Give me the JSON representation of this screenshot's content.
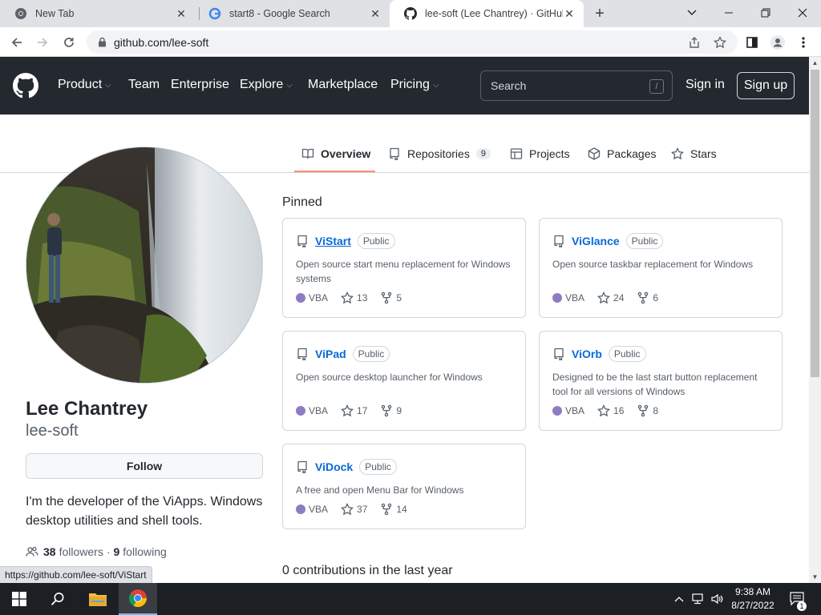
{
  "browser": {
    "tabs": [
      {
        "title": "New Tab"
      },
      {
        "title": "start8 - Google Search"
      },
      {
        "title": "lee-soft (Lee Chantrey) · GitHub"
      }
    ],
    "url": "github.com/lee-soft",
    "status_url": "https://github.com/lee-soft/ViStart"
  },
  "header": {
    "nav": [
      {
        "label": "Product",
        "dropdown": true
      },
      {
        "label": "Team",
        "dropdown": false
      },
      {
        "label": "Enterprise",
        "dropdown": false
      },
      {
        "label": "Explore",
        "dropdown": true
      },
      {
        "label": "Marketplace",
        "dropdown": false
      },
      {
        "label": "Pricing",
        "dropdown": true
      }
    ],
    "search_placeholder": "Search",
    "search_key": "/",
    "sign_in": "Sign in",
    "sign_up": "Sign up"
  },
  "profile_tabs": [
    {
      "label": "Overview",
      "icon": "book-icon"
    },
    {
      "label": "Repositories",
      "count": "9",
      "icon": "repo-icon"
    },
    {
      "label": "Projects",
      "icon": "table-icon"
    },
    {
      "label": "Packages",
      "icon": "package-icon"
    },
    {
      "label": "Stars",
      "icon": "star-icon"
    }
  ],
  "profile": {
    "name": "Lee Chantrey",
    "username": "lee-soft",
    "follow": "Follow",
    "bio": "I'm the developer of the ViApps. Windows desktop utilities and shell tools.",
    "followers_count": "38",
    "followers_label": "followers",
    "dot": "·",
    "following_count": "9",
    "following_label": "following"
  },
  "pinned": {
    "title": "Pinned",
    "repos": [
      {
        "name": "ViStart",
        "visibility": "Public",
        "description": "Open source start menu replacement for Windows systems",
        "language": "VBA",
        "language_color": "#8e7cc3",
        "stars": "13",
        "forks": "5"
      },
      {
        "name": "ViGlance",
        "visibility": "Public",
        "description": "Open source taskbar replacement for Windows",
        "language": "VBA",
        "language_color": "#8e7cc3",
        "stars": "24",
        "forks": "6"
      },
      {
        "name": "ViPad",
        "visibility": "Public",
        "description": "Open source desktop launcher for Windows",
        "language": "VBA",
        "language_color": "#8e7cc3",
        "stars": "17",
        "forks": "9"
      },
      {
        "name": "ViOrb",
        "visibility": "Public",
        "description": "Designed to be the last start button replacement tool for all versions of Windows",
        "language": "VBA",
        "language_color": "#8e7cc3",
        "stars": "16",
        "forks": "8"
      },
      {
        "name": "ViDock",
        "visibility": "Public",
        "description": "A free and open Menu Bar for Windows",
        "language": "VBA",
        "language_color": "#8e7cc3",
        "stars": "37",
        "forks": "14"
      }
    ]
  },
  "contributions": "0 contributions in the last year",
  "taskbar": {
    "time": "9:38 AM",
    "date": "8/27/2022",
    "notification_count": "1"
  }
}
